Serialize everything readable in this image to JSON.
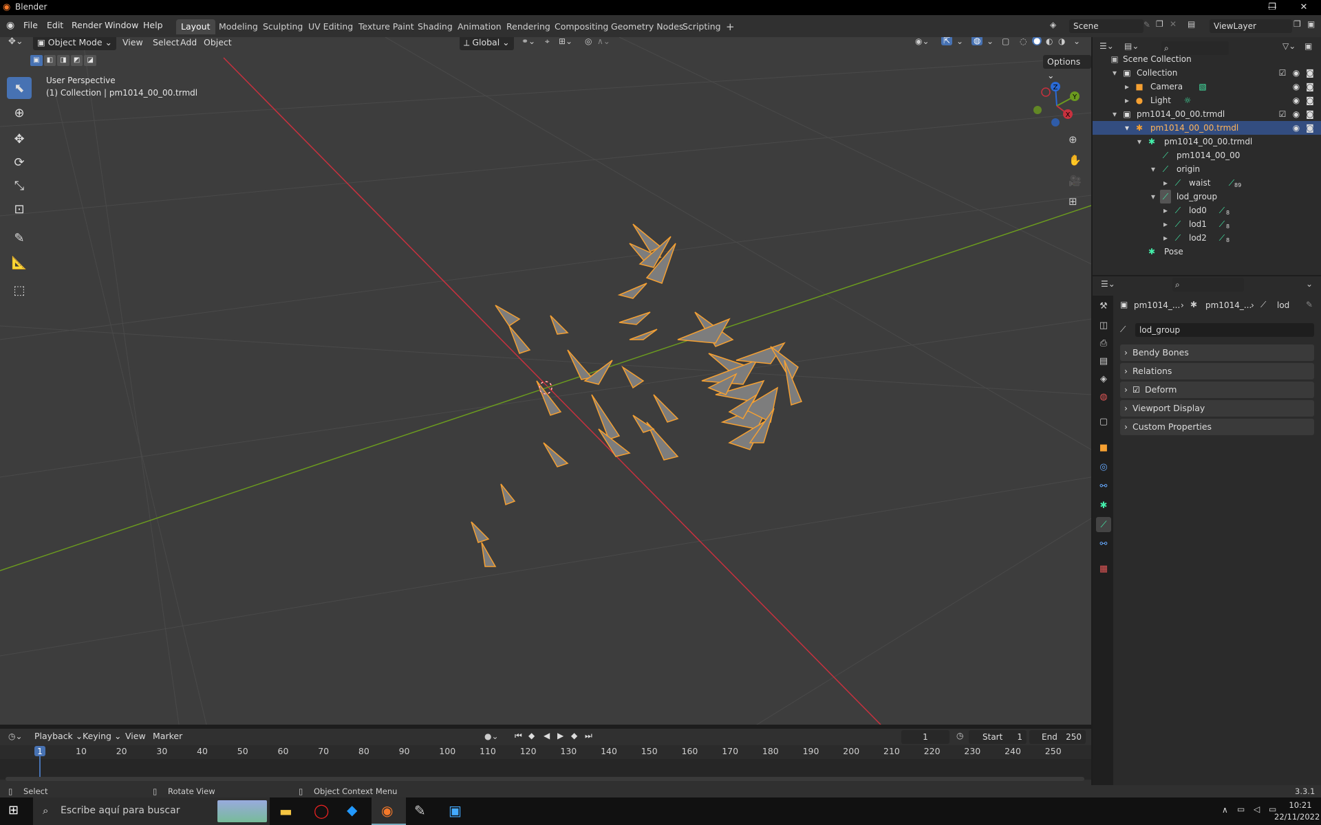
{
  "window": {
    "title": "Blender"
  },
  "menubar": {
    "file": "File",
    "edit": "Edit",
    "render": "Render",
    "window": "Window",
    "help": "Help",
    "workspaces": [
      "Layout",
      "Modeling",
      "Sculpting",
      "UV Editing",
      "Texture Paint",
      "Shading",
      "Animation",
      "Rendering",
      "Compositing",
      "Geometry Nodes",
      "Scripting"
    ],
    "scene": "Scene",
    "view_layer": "ViewLayer"
  },
  "viewport": {
    "mode": "Object Mode",
    "view": "View",
    "select": "Select",
    "add": "Add",
    "object": "Object",
    "orientation": "Global",
    "options": "Options",
    "perspective": "User Perspective",
    "collection_info": "(1) Collection | pm1014_00_00.trmdl",
    "gizmo": {
      "z": "Z",
      "y": "Y",
      "x": "X"
    }
  },
  "outliner": {
    "rows": [
      {
        "label": "Scene Collection"
      },
      {
        "label": "Collection"
      },
      {
        "label": "Camera"
      },
      {
        "label": "Light"
      },
      {
        "label": "pm1014_00_00.trmdl"
      },
      {
        "label": "pm1014_00_00.trmdl"
      },
      {
        "label": "pm1014_00_00.trmdl"
      },
      {
        "label": "pm1014_00_00"
      },
      {
        "label": "origin"
      },
      {
        "label": "waist",
        "badge": "89"
      },
      {
        "label": "lod_group"
      },
      {
        "label": "lod0",
        "badge": "8"
      },
      {
        "label": "lod1",
        "badge": "8"
      },
      {
        "label": "lod2",
        "badge": "8"
      },
      {
        "label": "Pose"
      }
    ]
  },
  "properties": {
    "breadcrumb": [
      "pm1014_...",
      "pm1014_...",
      "lod"
    ],
    "bone_name": "lod_group",
    "panels": [
      "Bendy Bones",
      "Relations",
      "Deform",
      "Viewport Display",
      "Custom Properties"
    ]
  },
  "timeline": {
    "playback": "Playback",
    "keying": "Keying",
    "view": "View",
    "marker": "Marker",
    "current_frame": "1",
    "start_label": "Start",
    "start": "1",
    "end_label": "End",
    "end": "250",
    "ticks": [
      "1",
      "10",
      "20",
      "30",
      "40",
      "50",
      "60",
      "70",
      "80",
      "90",
      "100",
      "110",
      "120",
      "130",
      "140",
      "150",
      "160",
      "170",
      "180",
      "190",
      "200",
      "210",
      "220",
      "230",
      "240",
      "250"
    ]
  },
  "statusbar": {
    "select": "Select",
    "rotate": "Rotate View",
    "context": "Object Context Menu",
    "version": "3.3.1"
  },
  "taskbar": {
    "search_placeholder": "Escribe aquí para buscar",
    "time": "10:21",
    "date": "22/11/2022"
  },
  "colors": {
    "accent": "#4772b3",
    "selected_row": "#334d80",
    "bone_orange": "#f5a032",
    "x_axis": "#c8313e",
    "y_axis": "#6b9a1f"
  }
}
